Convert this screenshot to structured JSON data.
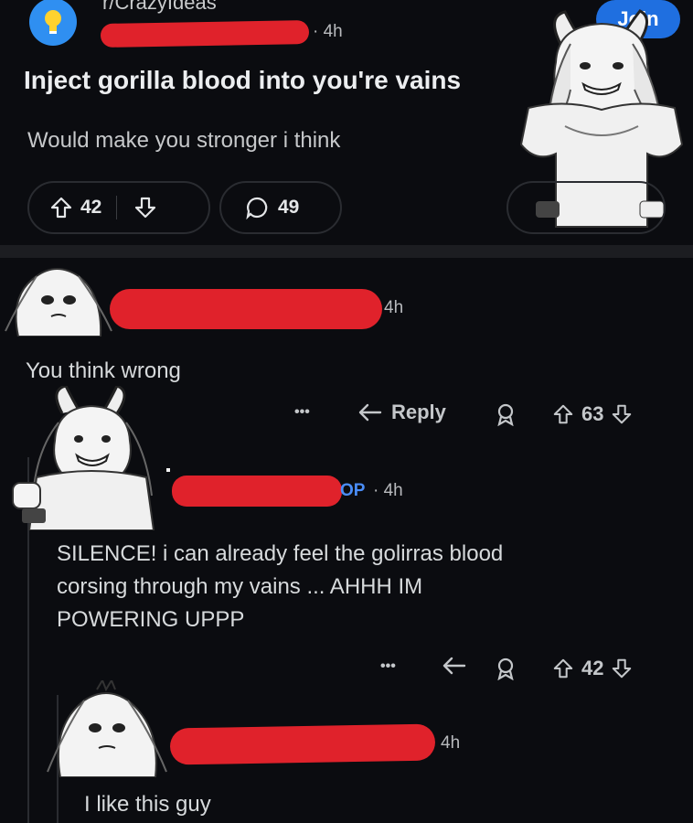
{
  "post": {
    "subreddit": "r/CrazyIdeas",
    "age": "· 4h",
    "join_label": "Join",
    "title": "Inject gorilla blood into you're vains",
    "body": "Would make you stronger i think",
    "upvotes": "42",
    "comments": "49"
  },
  "comments": [
    {
      "age": "4h",
      "text": "You think wrong",
      "more": "•••",
      "reply_label": "Reply",
      "votes": "63"
    },
    {
      "op_label": "OP",
      "age": "· 4h",
      "text_line1": "SILENCE! i can already feel the golirras blood",
      "text_line2": "corsing through my vains ... AHHH IM",
      "text_line3": "POWERING UPPP",
      "more": "•••",
      "votes": "42"
    },
    {
      "age": "4h",
      "text": "I like this guy"
    }
  ],
  "colors": {
    "background": "#0b0c10",
    "accent_blue": "#1f6fe0",
    "redaction": "#e0222b"
  }
}
